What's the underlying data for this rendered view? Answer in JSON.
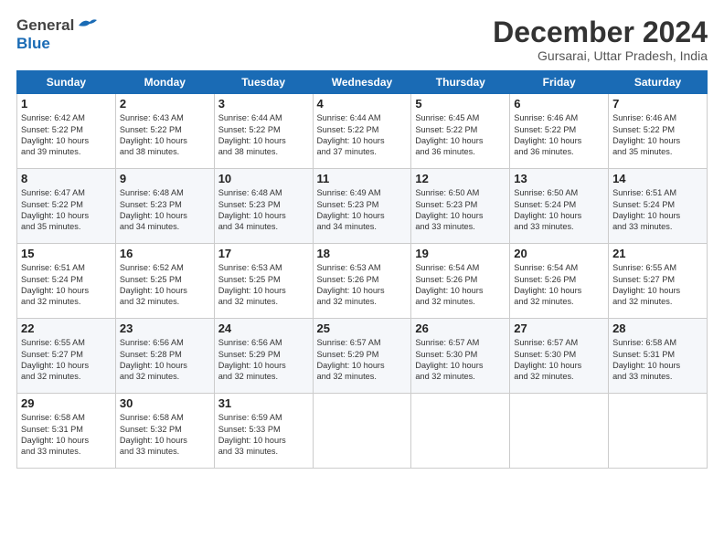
{
  "header": {
    "logo_general": "General",
    "logo_blue": "Blue",
    "title": "December 2024",
    "subtitle": "Gursarai, Uttar Pradesh, India"
  },
  "weekdays": [
    "Sunday",
    "Monday",
    "Tuesday",
    "Wednesday",
    "Thursday",
    "Friday",
    "Saturday"
  ],
  "weeks": [
    [
      {
        "day": "1",
        "info": "Sunrise: 6:42 AM\nSunset: 5:22 PM\nDaylight: 10 hours\nand 39 minutes."
      },
      {
        "day": "2",
        "info": "Sunrise: 6:43 AM\nSunset: 5:22 PM\nDaylight: 10 hours\nand 38 minutes."
      },
      {
        "day": "3",
        "info": "Sunrise: 6:44 AM\nSunset: 5:22 PM\nDaylight: 10 hours\nand 38 minutes."
      },
      {
        "day": "4",
        "info": "Sunrise: 6:44 AM\nSunset: 5:22 PM\nDaylight: 10 hours\nand 37 minutes."
      },
      {
        "day": "5",
        "info": "Sunrise: 6:45 AM\nSunset: 5:22 PM\nDaylight: 10 hours\nand 36 minutes."
      },
      {
        "day": "6",
        "info": "Sunrise: 6:46 AM\nSunset: 5:22 PM\nDaylight: 10 hours\nand 36 minutes."
      },
      {
        "day": "7",
        "info": "Sunrise: 6:46 AM\nSunset: 5:22 PM\nDaylight: 10 hours\nand 35 minutes."
      }
    ],
    [
      {
        "day": "8",
        "info": "Sunrise: 6:47 AM\nSunset: 5:22 PM\nDaylight: 10 hours\nand 35 minutes."
      },
      {
        "day": "9",
        "info": "Sunrise: 6:48 AM\nSunset: 5:23 PM\nDaylight: 10 hours\nand 34 minutes."
      },
      {
        "day": "10",
        "info": "Sunrise: 6:48 AM\nSunset: 5:23 PM\nDaylight: 10 hours\nand 34 minutes."
      },
      {
        "day": "11",
        "info": "Sunrise: 6:49 AM\nSunset: 5:23 PM\nDaylight: 10 hours\nand 34 minutes."
      },
      {
        "day": "12",
        "info": "Sunrise: 6:50 AM\nSunset: 5:23 PM\nDaylight: 10 hours\nand 33 minutes."
      },
      {
        "day": "13",
        "info": "Sunrise: 6:50 AM\nSunset: 5:24 PM\nDaylight: 10 hours\nand 33 minutes."
      },
      {
        "day": "14",
        "info": "Sunrise: 6:51 AM\nSunset: 5:24 PM\nDaylight: 10 hours\nand 33 minutes."
      }
    ],
    [
      {
        "day": "15",
        "info": "Sunrise: 6:51 AM\nSunset: 5:24 PM\nDaylight: 10 hours\nand 32 minutes."
      },
      {
        "day": "16",
        "info": "Sunrise: 6:52 AM\nSunset: 5:25 PM\nDaylight: 10 hours\nand 32 minutes."
      },
      {
        "day": "17",
        "info": "Sunrise: 6:53 AM\nSunset: 5:25 PM\nDaylight: 10 hours\nand 32 minutes."
      },
      {
        "day": "18",
        "info": "Sunrise: 6:53 AM\nSunset: 5:26 PM\nDaylight: 10 hours\nand 32 minutes."
      },
      {
        "day": "19",
        "info": "Sunrise: 6:54 AM\nSunset: 5:26 PM\nDaylight: 10 hours\nand 32 minutes."
      },
      {
        "day": "20",
        "info": "Sunrise: 6:54 AM\nSunset: 5:26 PM\nDaylight: 10 hours\nand 32 minutes."
      },
      {
        "day": "21",
        "info": "Sunrise: 6:55 AM\nSunset: 5:27 PM\nDaylight: 10 hours\nand 32 minutes."
      }
    ],
    [
      {
        "day": "22",
        "info": "Sunrise: 6:55 AM\nSunset: 5:27 PM\nDaylight: 10 hours\nand 32 minutes."
      },
      {
        "day": "23",
        "info": "Sunrise: 6:56 AM\nSunset: 5:28 PM\nDaylight: 10 hours\nand 32 minutes."
      },
      {
        "day": "24",
        "info": "Sunrise: 6:56 AM\nSunset: 5:29 PM\nDaylight: 10 hours\nand 32 minutes."
      },
      {
        "day": "25",
        "info": "Sunrise: 6:57 AM\nSunset: 5:29 PM\nDaylight: 10 hours\nand 32 minutes."
      },
      {
        "day": "26",
        "info": "Sunrise: 6:57 AM\nSunset: 5:30 PM\nDaylight: 10 hours\nand 32 minutes."
      },
      {
        "day": "27",
        "info": "Sunrise: 6:57 AM\nSunset: 5:30 PM\nDaylight: 10 hours\nand 32 minutes."
      },
      {
        "day": "28",
        "info": "Sunrise: 6:58 AM\nSunset: 5:31 PM\nDaylight: 10 hours\nand 33 minutes."
      }
    ],
    [
      {
        "day": "29",
        "info": "Sunrise: 6:58 AM\nSunset: 5:31 PM\nDaylight: 10 hours\nand 33 minutes."
      },
      {
        "day": "30",
        "info": "Sunrise: 6:58 AM\nSunset: 5:32 PM\nDaylight: 10 hours\nand 33 minutes."
      },
      {
        "day": "31",
        "info": "Sunrise: 6:59 AM\nSunset: 5:33 PM\nDaylight: 10 hours\nand 33 minutes."
      },
      {
        "day": "",
        "info": ""
      },
      {
        "day": "",
        "info": ""
      },
      {
        "day": "",
        "info": ""
      },
      {
        "day": "",
        "info": ""
      }
    ]
  ]
}
